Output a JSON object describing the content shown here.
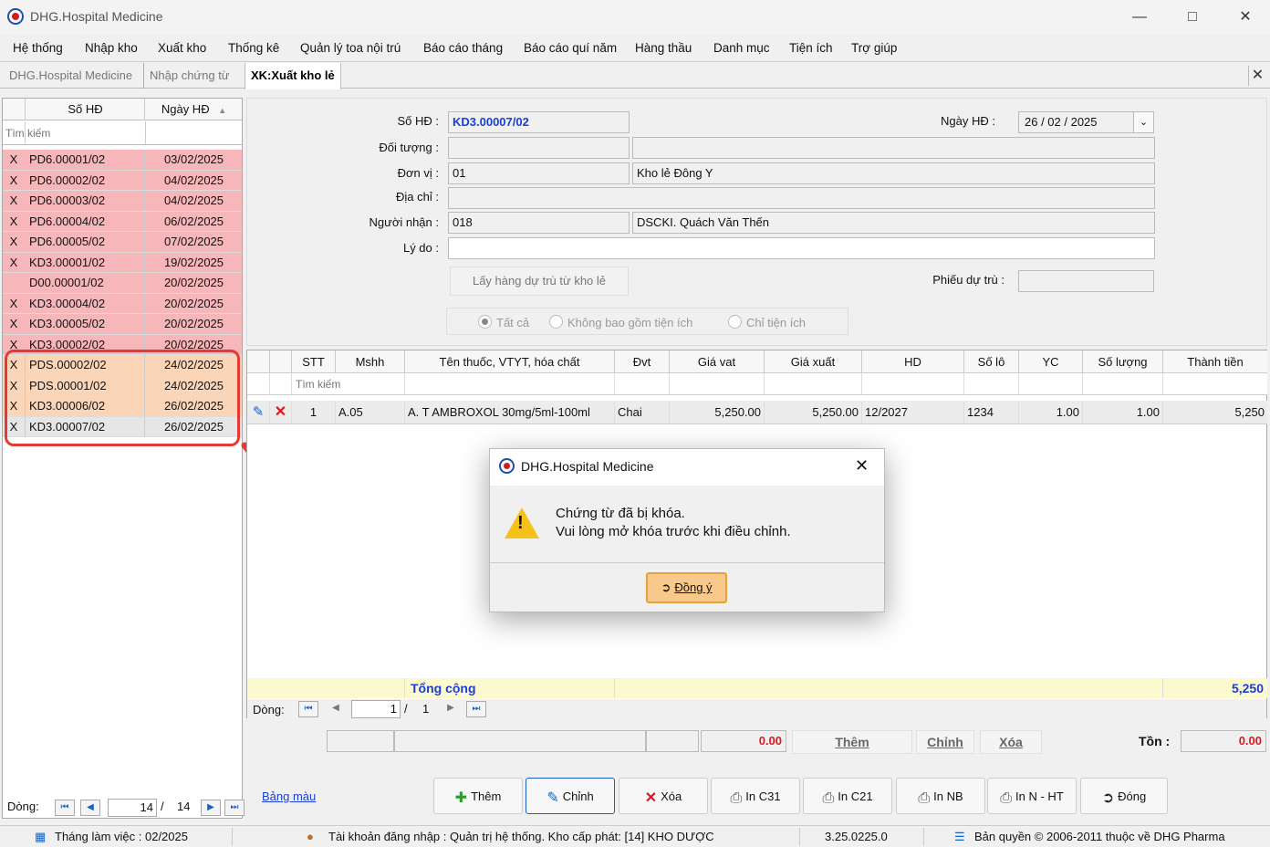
{
  "window": {
    "title": "DHG.Hospital Medicine"
  },
  "menu": [
    "Hệ thống",
    "Nhập kho",
    "Xuất kho",
    "Thống kê",
    "Quản lý toa nội trú",
    "Báo cáo tháng",
    "Báo cáo quí năm",
    "Hàng thầu",
    "Danh mục",
    "Tiện ích",
    "Trợ giúp"
  ],
  "tabs": [
    {
      "label": "DHG.Hospital Medicine"
    },
    {
      "label": "Nhập chứng từ"
    },
    {
      "label": "XK:Xuất kho lẻ"
    }
  ],
  "left_list": {
    "col_so": "Số HĐ",
    "col_ngay": "Ngày HĐ",
    "search_placeholder": "Tìm kiếm",
    "rows": [
      {
        "x": "X",
        "so": "PD6.00001/02",
        "ngay": "03/02/2025"
      },
      {
        "x": "X",
        "so": "PD6.00002/02",
        "ngay": "04/02/2025"
      },
      {
        "x": "X",
        "so": "PD6.00003/02",
        "ngay": "04/02/2025"
      },
      {
        "x": "X",
        "so": "PD6.00004/02",
        "ngay": "06/02/2025"
      },
      {
        "x": "X",
        "so": "PD6.00005/02",
        "ngay": "07/02/2025"
      },
      {
        "x": "X",
        "so": "KD3.00001/02",
        "ngay": "19/02/2025"
      },
      {
        "x": "",
        "so": "D00.00001/02",
        "ngay": "20/02/2025"
      },
      {
        "x": "X",
        "so": "KD3.00004/02",
        "ngay": "20/02/2025"
      },
      {
        "x": "X",
        "so": "KD3.00005/02",
        "ngay": "20/02/2025"
      },
      {
        "x": "X",
        "so": "KD3.00002/02",
        "ngay": "20/02/2025"
      },
      {
        "x": "X",
        "so": "PDS.00002/02",
        "ngay": "24/02/2025"
      },
      {
        "x": "X",
        "so": "PDS.00001/02",
        "ngay": "24/02/2025"
      },
      {
        "x": "X",
        "so": "KD3.00006/02",
        "ngay": "26/02/2025"
      },
      {
        "x": "X",
        "so": "KD3.00007/02",
        "ngay": "26/02/2025"
      }
    ],
    "footer_label": "Dòng:",
    "current": "14",
    "total": "14"
  },
  "form": {
    "so_hd_label": "Số HĐ :",
    "so_hd": "KD3.00007/02",
    "ngay_hd_label": "Ngày HĐ :",
    "ngay_hd": "26 / 02 / 2025",
    "doi_tuong_label": "Đối tượng :",
    "don_vi_label": "Đơn vị :",
    "don_vi_code": "01",
    "don_vi_name": "Kho lẻ Đông Y",
    "dia_chi_label": "Địa chỉ :",
    "nguoi_nhan_label": "Người nhận :",
    "nguoi_nhan_code": "018",
    "nguoi_nhan_name": "DSCKI. Quách Văn Thến",
    "ly_do_label": "Lý do :",
    "lay_hang_button": "Lấy hàng dự trù từ kho lẻ",
    "phieu_du_tru_label": "Phiếu dự trù :",
    "radio_all": "Tất cả",
    "radio_no_util": "Không bao gồm tiện ích",
    "radio_util_only": "Chỉ tiện ích"
  },
  "grid": {
    "headers": [
      "STT",
      "Mshh",
      "Tên thuốc, VTYT, hóa chất",
      "Đvt",
      "Giá vat",
      "Giá xuất",
      "HD",
      "Số lô",
      "YC",
      "Số lượng",
      "Thành tiền"
    ],
    "search_placeholder": "Tìm kiếm",
    "row": {
      "stt": "1",
      "mshh": "A.05",
      "ten": "A. T AMBROXOL 30mg/5ml-100ml",
      "dvt": "Chai",
      "gia_vat": "5,250.00",
      "gia_xuat": "5,250.00",
      "hd": "12/2027",
      "so_lo": "1234",
      "yc": "1.00",
      "so_luong": "1.00",
      "thanh_tien": "5,250"
    },
    "total_label": "Tổng cộng",
    "total_value": "5,250",
    "footer_label": "Dòng:",
    "current": "1",
    "total": "1"
  },
  "summary": {
    "value1": "0.00",
    "them": "Thêm",
    "chinh": "Chỉnh",
    "xoa": "Xóa",
    "ton_label": "Tồn :",
    "ton_value": "0.00"
  },
  "toolbar": {
    "bang_mau": "Bảng màu",
    "them": "Thêm",
    "chinh": "Chỉnh",
    "xoa": "Xóa",
    "in_c31": "In C31",
    "in_c21": "In C21",
    "in_nb": "In NB",
    "in_n_ht": "In N - HT",
    "dong": "Đóng"
  },
  "status": {
    "thang": "Tháng làm việc : 02/2025",
    "tai_khoan": "Tài khoản đăng nhập : Quản trị hệ thống. Kho cấp phát: [14] KHO DƯỢC",
    "version": "3.25.0225.0",
    "ban_quyen": "Bản quyền © 2006-2011 thuộc về DHG Pharma"
  },
  "dialog": {
    "title": "DHG.Hospital Medicine",
    "line1": "Chứng từ đã bị khóa.",
    "line2": "Vui lòng mở khóa trước khi điều chỉnh.",
    "ok": "Đồng ý"
  },
  "colors": {
    "locked_row": "#f7b6b9",
    "pending_row": "#fbd5b7",
    "accent_blue": "#1a3fd6",
    "highlight_red": "#e53935"
  }
}
